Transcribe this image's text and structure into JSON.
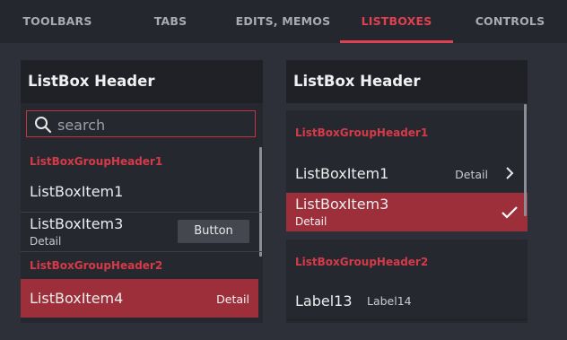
{
  "tabs": [
    "TOOLBARS",
    "TABS",
    "EDITS, MEMOS",
    "LISTBOXES",
    "CONTROLS"
  ],
  "active_tab": "LISTBOXES",
  "accent_color": "#e0404f",
  "left": {
    "header": "ListBox Header",
    "search_placeholder": "search",
    "group1": "ListBoxGroupHeader1",
    "item1": "ListBoxItem1",
    "item3": "ListBoxItem3",
    "item3_detail": "Detail",
    "button": "Button",
    "group2": "ListBoxGroupHeader2",
    "item4": "ListBoxItem4",
    "item4_detail": "Detail"
  },
  "right": {
    "header": "ListBox Header",
    "group1": "ListBoxGroupHeader1",
    "item1": "ListBoxItem1",
    "item1_detail": "Detail",
    "item3": "ListBoxItem3",
    "item3_detail": "Detail",
    "group2": "ListBoxGroupHeader2",
    "label13": "Label13",
    "label14": "Label14"
  },
  "icons": {
    "search": "search-icon",
    "chevron": "chevron-right-icon",
    "check": "checkmark-icon"
  }
}
